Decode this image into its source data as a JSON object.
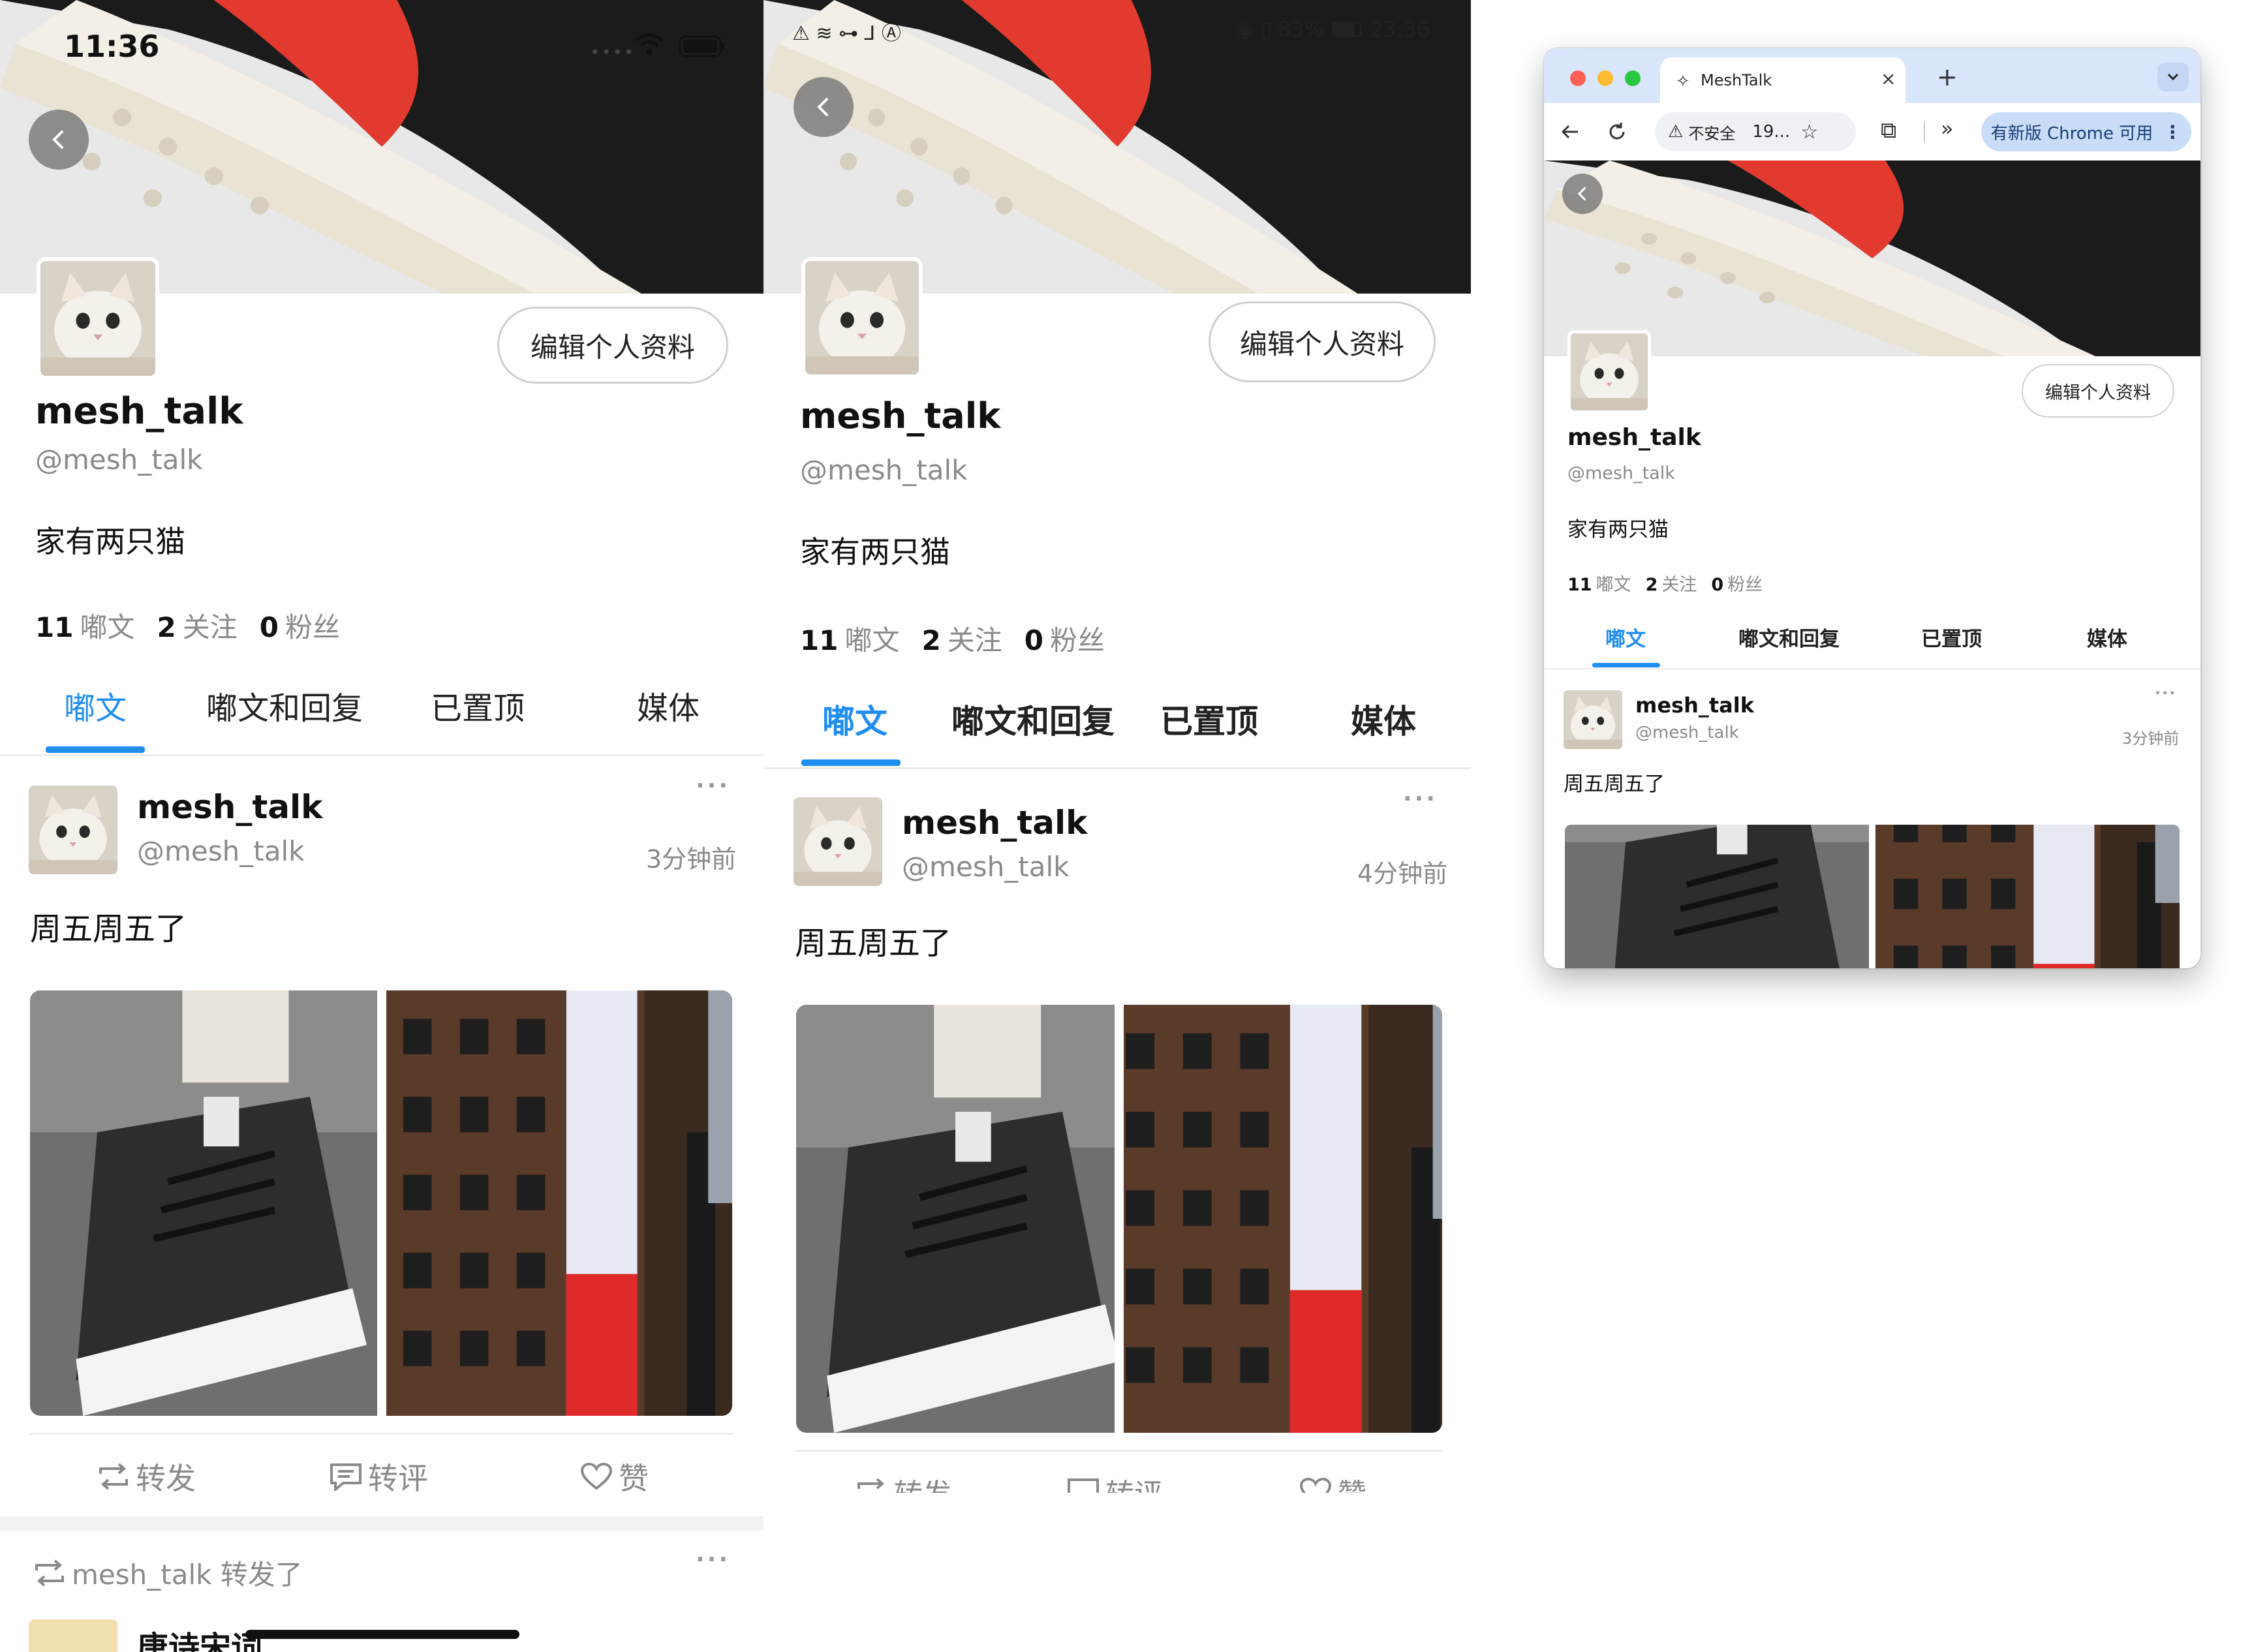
{
  "status_left": {
    "time": "11:36"
  },
  "status_mid": {
    "time": "23:36",
    "battery": "83%"
  },
  "browser": {
    "tab_title": "MeshTalk",
    "security_label": "不安全",
    "url": "19...",
    "update_label": "有新版 Chrome 可用"
  },
  "profile": {
    "edit_label": "编辑个人资料",
    "name": "mesh_talk",
    "handle": "@mesh_talk",
    "bio": "家有两只猫",
    "stats": [
      {
        "value": "11",
        "label": "嘟文"
      },
      {
        "value": "2",
        "label": "关注"
      },
      {
        "value": "0",
        "label": "粉丝"
      }
    ],
    "tabs": [
      "嘟文",
      "嘟文和回复",
      "已置顶",
      "媒体"
    ],
    "active_tab": 0
  },
  "post": {
    "name": "mesh_talk",
    "handle": "@mesh_talk",
    "time_left": "3分钟前",
    "time_mid": "4分钟前",
    "time_browser": "3分钟前",
    "text": "周五周五了",
    "actions": {
      "boost": "转发",
      "quote": "转评",
      "like": "赞"
    }
  },
  "reblog": {
    "label": "mesh_talk 转发了",
    "name": "唐诗宋词"
  },
  "icons": [
    "back-arrow-icon",
    "wifi-icon",
    "battery-icon",
    "more-dots-icon",
    "boost-icon",
    "quote-icon",
    "heart-icon",
    "reload-icon",
    "star-icon",
    "extensions-icon",
    "warning-icon"
  ],
  "colors": {
    "accent": "#1f8ef1",
    "muted": "#8a8a8a",
    "shoe_red": "#e23a2e"
  }
}
